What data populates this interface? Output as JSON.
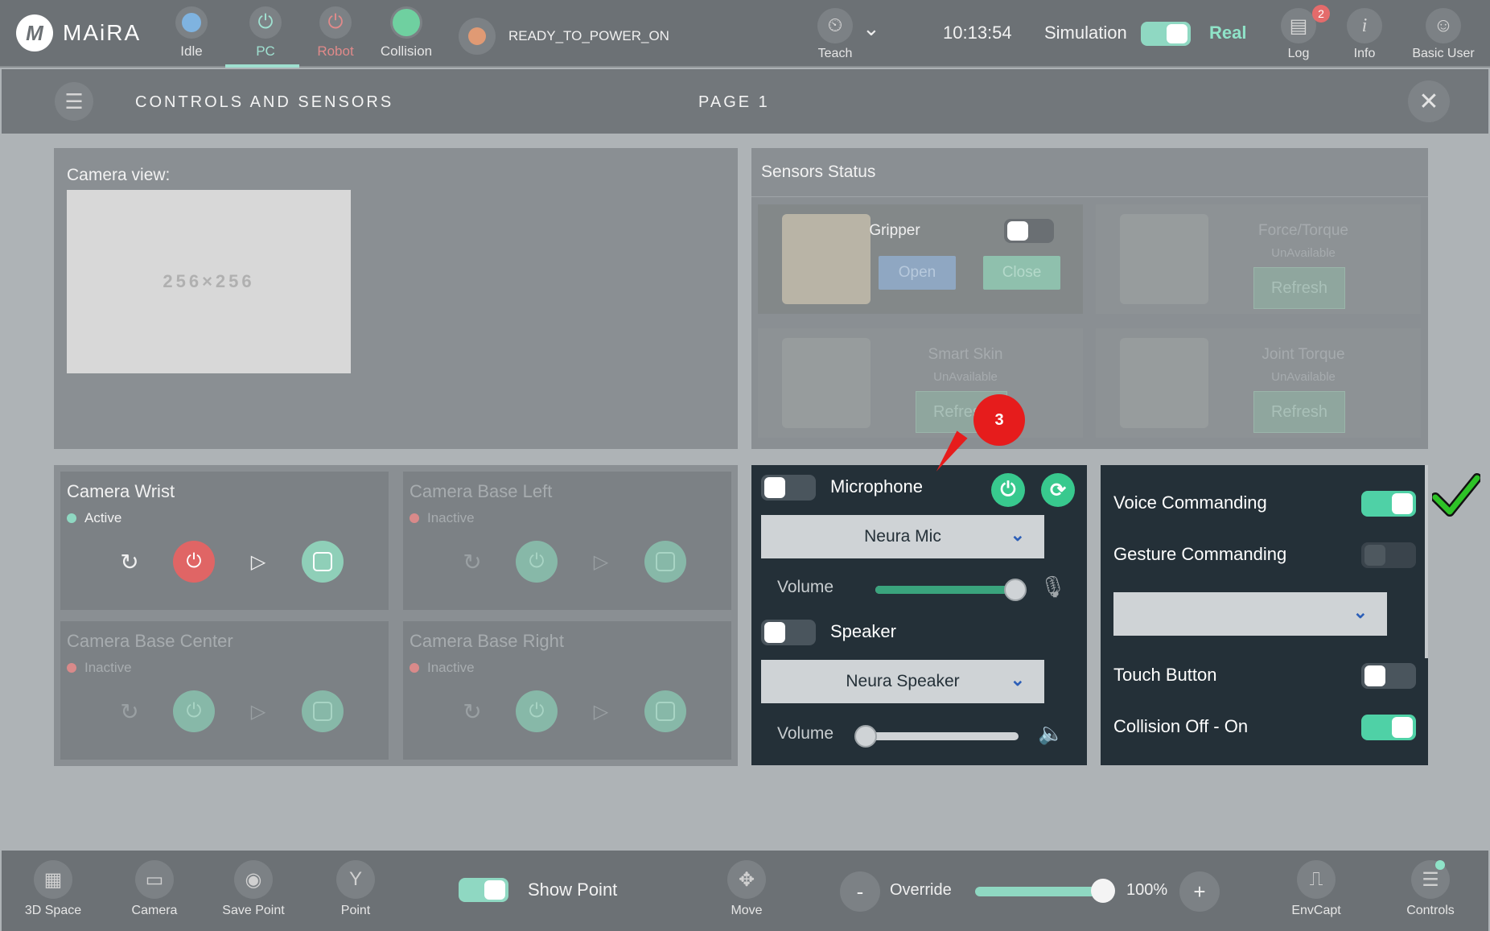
{
  "topbar": {
    "logo_mark": "M",
    "logo_text": "MAiRA",
    "status": [
      {
        "label": "Idle",
        "color": "#7fb3e0"
      },
      {
        "label": "PC",
        "color": "#9fe0d0"
      },
      {
        "label": "Robot",
        "color": "#e08a8a"
      },
      {
        "label": "Collision",
        "color": "#6fd0a0"
      }
    ],
    "robot_state": "READY_TO_POWER_ON",
    "teach_label": "Teach",
    "clock": "10:13:54",
    "simulation_label": "Simulation",
    "real_label": "Real",
    "log_label": "Log",
    "log_badge": "2",
    "info_label": "Info",
    "user_label": "Basic User"
  },
  "header": {
    "title": "CONTROLS AND SENSORS",
    "page": "PAGE 1"
  },
  "camera_view": {
    "label": "Camera view:",
    "placeholder": "256×256"
  },
  "cameras": [
    {
      "title": "Camera Wrist",
      "status": "Active",
      "status_color": "#8fd8c2"
    },
    {
      "title": "Camera Base Left",
      "status": "Inactive",
      "status_color": "#d98a8a"
    },
    {
      "title": "Camera Base Center",
      "status": "Inactive",
      "status_color": "#d98a8a"
    },
    {
      "title": "Camera Base Right",
      "status": "Inactive",
      "status_color": "#d98a8a"
    }
  ],
  "sensors": {
    "title": "Sensors Status",
    "gripper": {
      "name": "Gripper",
      "open": "Open",
      "close": "Close"
    },
    "force_torque": {
      "name": "Force/Torque",
      "availability": "UnAvailable",
      "refresh": "Refresh"
    },
    "smart_skin": {
      "name": "Smart Skin",
      "availability": "UnAvailable",
      "refresh": "Refresh"
    },
    "joint_torque": {
      "name": "Joint Torque",
      "availability": "UnAvailable",
      "refresh": "Refresh"
    }
  },
  "audio": {
    "microphone_label": "Microphone",
    "microphone_device": "Neura Mic",
    "mic_volume_label": "Volume",
    "mic_volume": 0.98,
    "speaker_label": "Speaker",
    "speaker_device": "Neura Speaker",
    "speaker_volume_label": "Volume",
    "speaker_volume": 0.0
  },
  "commanding": {
    "voice": "Voice Commanding",
    "gesture": "Gesture Commanding",
    "touch": "Touch Button",
    "collision": "Collision Off - On"
  },
  "annotation": {
    "number": "3"
  },
  "bottombar": {
    "space3d": "3D Space",
    "camera": "Camera",
    "save_point": "Save Point",
    "point": "Point",
    "show_point": "Show Point",
    "move": "Move",
    "override_label": "Override",
    "override_minus": "-",
    "override_plus": "+",
    "override_value": "100%",
    "envcapt": "EnvCapt",
    "controls": "Controls"
  }
}
